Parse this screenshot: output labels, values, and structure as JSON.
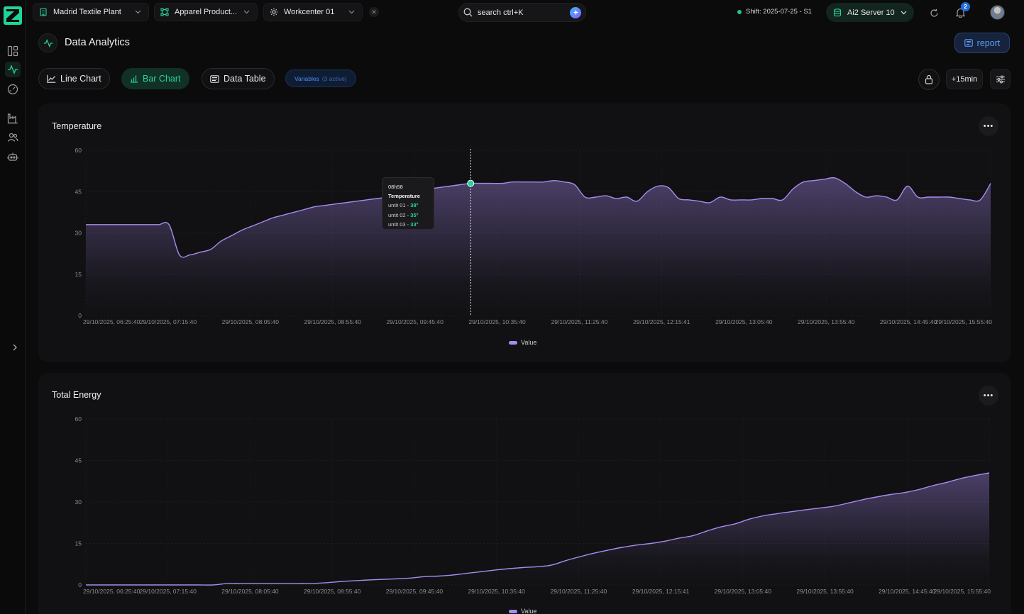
{
  "topbar": {
    "plant": "Madrid Textile Plant",
    "line": "Apparel Product...",
    "workcenter": "Workcenter 01",
    "search_label": "search ctrl+K",
    "shift": "Shift: 2025-07-25 - S1",
    "server": "Ai2 Server 10",
    "notifications": "2"
  },
  "header": {
    "title": "Data Analytics",
    "report_label": "report"
  },
  "toolbar": {
    "line_chart": "Line Chart",
    "bar_chart": "Bar Chart",
    "data_table": "Data Table",
    "variables_label": "Variables",
    "variables_count": "(3 active)",
    "time_offset": "+15min"
  },
  "tooltip": {
    "time": "08h58",
    "name": "Temperature",
    "rows": [
      {
        "label": "untit 01 - ",
        "value": "38°"
      },
      {
        "label": "untit 02 - ",
        "value": "35°"
      },
      {
        "label": "untit 03 - ",
        "value": "33°"
      }
    ]
  },
  "colors": {
    "accent": "#2bd39a",
    "series": "#a98bf0",
    "report": "#5f9bff"
  },
  "chart_data": [
    {
      "type": "area",
      "title": "Temperature",
      "ylim": [
        0,
        60
      ],
      "yticks": [
        "0",
        "15",
        "30",
        "45",
        "60"
      ],
      "xticks": [
        "29/10/2025, 06:25:40",
        "29/10/2025, 07:15:40",
        "29/10/2025, 08:05:40",
        "29/10/2025, 08:55:40",
        "29/10/2025, 09:45:40",
        "29/10/2025, 10:35:40",
        "29/10/2025, 11:25:40",
        "29/10/2025, 12:15:41",
        "29/10/2025, 13:05:40",
        "29/10/2025, 13:55:40",
        "29/10/2025, 14:45:40",
        "29/10/2025, 15:55:40"
      ],
      "legend": "Value",
      "series": [
        {
          "name": "Value",
          "values": [
            33,
            33,
            33,
            33,
            33,
            33,
            33,
            33,
            33,
            22,
            22,
            23,
            24,
            27,
            29,
            31,
            32.5,
            34,
            35.5,
            36.5,
            37.5,
            38.5,
            39.5,
            40,
            40.5,
            41,
            41.5,
            42,
            42.5,
            43,
            44,
            45,
            45.5,
            46,
            46.5,
            47,
            47.5,
            48,
            48,
            48,
            48,
            48.5,
            48.5,
            48.5,
            48.5,
            49,
            48.5,
            47.5,
            43,
            43,
            43.5,
            42.5,
            43,
            41.5,
            45,
            47,
            46.5,
            42.5,
            42,
            41.5,
            41,
            43,
            42,
            42,
            42,
            42.5,
            42.5,
            42,
            46,
            48.5,
            49,
            49.5,
            50,
            48,
            45,
            43,
            43.5,
            43,
            42,
            47,
            43,
            43,
            43,
            43,
            42.5,
            42,
            42,
            48
          ]
        }
      ]
    },
    {
      "type": "area",
      "title": "Total Energy",
      "ylim": [
        0,
        60
      ],
      "yticks": [
        "0",
        "15",
        "30",
        "45",
        "60"
      ],
      "xticks": [
        "29/10/2025, 06:25:40",
        "29/10/2025, 07:15:40",
        "29/10/2025, 08:05:40",
        "29/10/2025, 08:55:40",
        "29/10/2025, 09:45:40",
        "29/10/2025, 10:35:40",
        "29/10/2025, 11:25:40",
        "29/10/2025, 12:15:41",
        "29/10/2025, 13:05:40",
        "29/10/2025, 13:55:40",
        "29/10/2025, 14:45:40",
        "29/10/2025, 15:55:40"
      ],
      "legend": "Value",
      "series": [
        {
          "name": "Value",
          "values": [
            0,
            0,
            0,
            0,
            0,
            0,
            0,
            0,
            0,
            0,
            0.5,
            0.5,
            0.5,
            0.5,
            0.5,
            0.5,
            0.5,
            0.8,
            1.2,
            1.5,
            1.8,
            2,
            2.2,
            2.5,
            3,
            3.2,
            3.6,
            4.2,
            4.8,
            5.4,
            5.9,
            6.3,
            6.6,
            7.2,
            8.8,
            10.2,
            11.5,
            12.6,
            13.6,
            14.4,
            15,
            15.8,
            16.9,
            17.8,
            19.5,
            21,
            22.1,
            23.8,
            25,
            25.8,
            26.5,
            27.2,
            27.8,
            28.5,
            29.6,
            30.8,
            31.8,
            32.7,
            33.4,
            34.5,
            35.9,
            37.1,
            38.5,
            39.6,
            40.5
          ]
        }
      ]
    }
  ]
}
